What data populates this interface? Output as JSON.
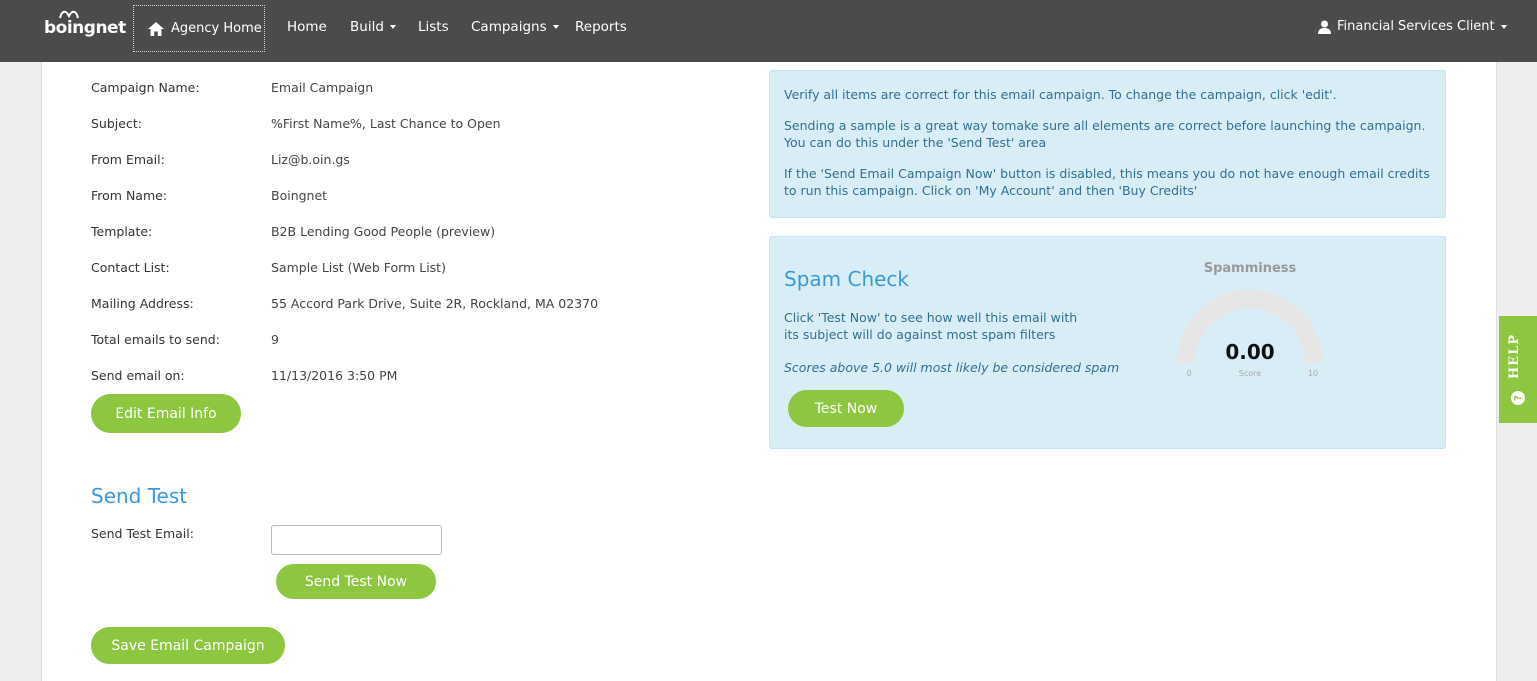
{
  "nav": {
    "logo": "boingnet",
    "agency_home": "Agency Home",
    "links": [
      "Home",
      "Build",
      "Lists",
      "Campaigns",
      "Reports"
    ],
    "user": "Financial Services Client"
  },
  "details": [
    {
      "label": "Campaign Name:",
      "value": "Email Campaign"
    },
    {
      "label": "Subject:",
      "value": "%First Name%, Last Chance to Open"
    },
    {
      "label": "From Email:",
      "value": "Liz@b.oin.gs"
    },
    {
      "label": "From Name:",
      "value": "Boingnet"
    },
    {
      "label": "Template:",
      "value": "B2B Lending Good People (preview)"
    },
    {
      "label": "Contact List:",
      "value": "Sample List (Web Form List)"
    },
    {
      "label": "Mailing Address:",
      "value": "55 Accord Park Drive, Suite 2R, Rockland, MA 02370"
    },
    {
      "label": "Total emails to send:",
      "value": "9"
    },
    {
      "label": "Send email on:",
      "value": "11/13/2016 3:50 PM"
    }
  ],
  "buttons": {
    "edit": "Edit Email Info",
    "send_test": "Send Test Now",
    "save": "Save Email Campaign",
    "test_now": "Test Now"
  },
  "send_test": {
    "title": "Send Test",
    "label": "Send Test Email:",
    "value": ""
  },
  "info": {
    "p1": "Verify all items are correct for this email campaign. To change the campaign, click 'edit'.",
    "p2": "Sending a sample is a great way tomake sure all elements are correct before launching the campaign. You can do this under the 'Send Test' area",
    "p3": "If the 'Send Email Campaign Now' button is disabled, this means you do not have enough email credits to run this campaign. Click on 'My Account' and then 'Buy Credits'"
  },
  "spam": {
    "title": "Spam Check",
    "desc": "Click 'Test Now' to see how well this email with its subject will do against most spam filters",
    "note": "Scores above 5.0 will most likely be considered spam",
    "gauge_title": "Spamminess",
    "score": "0.00",
    "score_label": "Score",
    "min": "0",
    "max": "10"
  },
  "help": {
    "label": "HELP",
    "icon": "?"
  },
  "colors": {
    "accent_green": "#8dc63f",
    "nav_bg": "#4b4b4b",
    "title_blue": "#3a9ad9",
    "info_bg": "#d9edf7"
  }
}
